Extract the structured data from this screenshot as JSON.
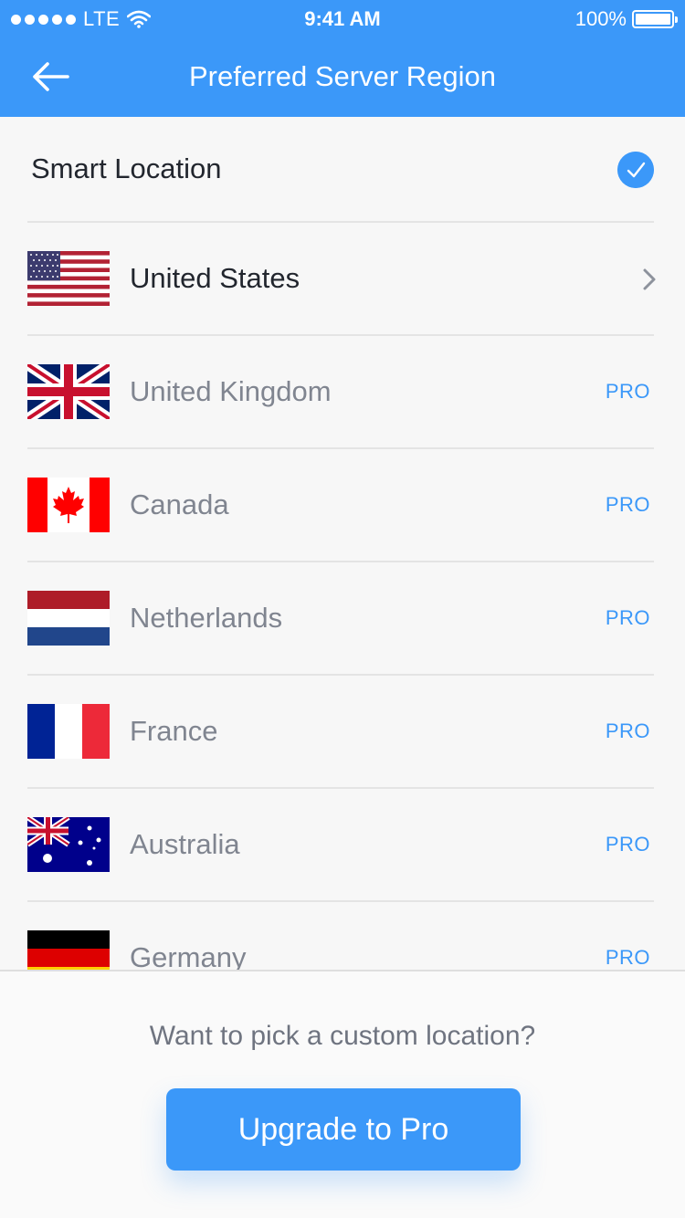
{
  "status_bar": {
    "carrier": "LTE",
    "time": "9:41 AM",
    "battery": "100%"
  },
  "nav": {
    "title": "Preferred Server Region",
    "back_icon": "arrow-left-icon"
  },
  "smart_location": {
    "label": "Smart Location",
    "selected": true
  },
  "regions": [
    {
      "name": "United States",
      "badge": "",
      "flag": "us-flag-icon"
    },
    {
      "name": "United Kingdom",
      "badge": "PRO",
      "flag": "uk-flag-icon"
    },
    {
      "name": "Canada",
      "badge": "PRO",
      "flag": "canada-flag-icon"
    },
    {
      "name": "Netherlands",
      "badge": "PRO",
      "flag": "netherlands-flag-icon"
    },
    {
      "name": "France",
      "badge": "PRO",
      "flag": "france-flag-icon"
    },
    {
      "name": "Australia",
      "badge": "PRO",
      "flag": "australia-flag-icon"
    },
    {
      "name": "Germany",
      "badge": "PRO",
      "flag": "germany-flag-icon"
    }
  ],
  "footer": {
    "prompt": "Want to pick a custom location?",
    "button": "Upgrade to Pro"
  },
  "colors": {
    "accent": "#3b98f9",
    "text_dark": "#22262e",
    "text_muted": "#808590"
  }
}
